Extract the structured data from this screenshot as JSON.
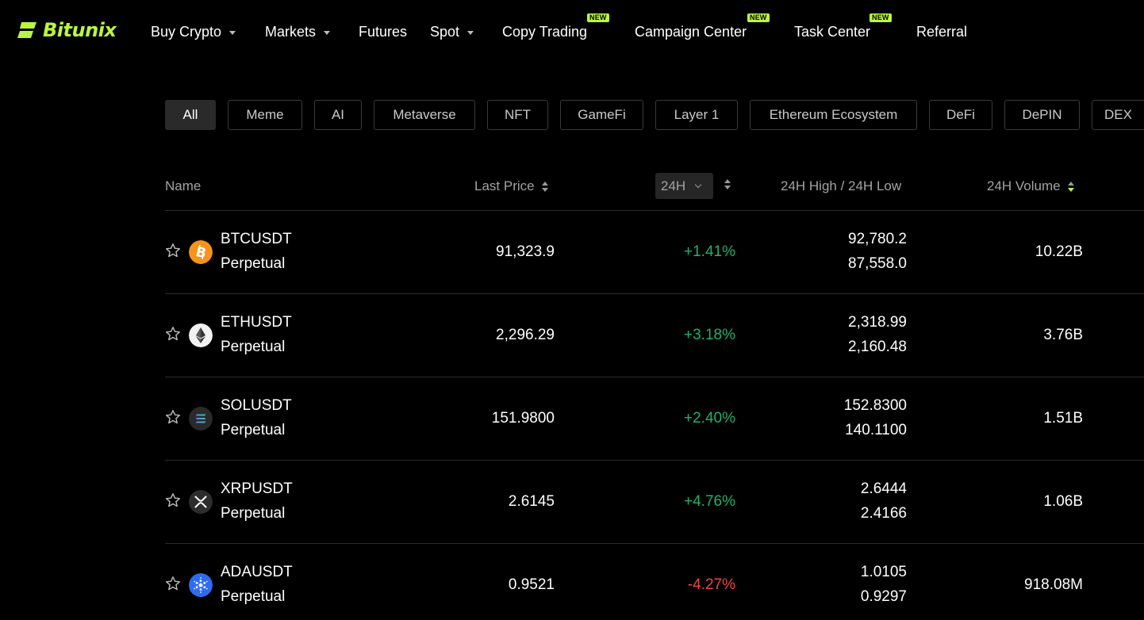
{
  "brand": {
    "name": "Bitunix",
    "accent_color": "#b9f641"
  },
  "nav": {
    "items": [
      {
        "label": "Buy Crypto",
        "dropdown": true
      },
      {
        "label": "Markets",
        "dropdown": true
      },
      {
        "label": "Futures",
        "dropdown": false
      },
      {
        "label": "Spot",
        "dropdown": true
      },
      {
        "label": "Copy Trading",
        "dropdown": false,
        "badge": "NEW"
      },
      {
        "label": "Campaign Center",
        "dropdown": false,
        "badge": "NEW"
      },
      {
        "label": "Task Center",
        "dropdown": false,
        "badge": "NEW"
      },
      {
        "label": "Referral",
        "dropdown": false
      }
    ]
  },
  "categories": {
    "selected": "All",
    "items": [
      "All",
      "Meme",
      "AI",
      "Metaverse",
      "NFT",
      "GameFi",
      "Layer 1",
      "Ethereum Ecosystem",
      "DeFi",
      "DePIN",
      "DEX"
    ]
  },
  "table": {
    "columns": {
      "name": "Name",
      "last_price": "Last Price",
      "period": "24H",
      "high_low": "24H High / 24H Low",
      "volume": "24H Volume"
    },
    "sorted_by": "24H Volume",
    "sort_direction": "descending",
    "positive_color": "#20b26c",
    "negative_color": "#ef454a",
    "rows": [
      {
        "symbol": "BTCUSDT",
        "type": "Perpetual",
        "coin_icon": "bitcoin-icon",
        "last_price": "91,323.9",
        "change": "+1.41%",
        "direction": "up",
        "high": "92,780.2",
        "low": "87,558.0",
        "volume": "10.22B"
      },
      {
        "symbol": "ETHUSDT",
        "type": "Perpetual",
        "coin_icon": "ethereum-icon",
        "last_price": "2,296.29",
        "change": "+3.18%",
        "direction": "up",
        "high": "2,318.99",
        "low": "2,160.48",
        "volume": "3.76B"
      },
      {
        "symbol": "SOLUSDT",
        "type": "Perpetual",
        "coin_icon": "solana-icon",
        "last_price": "151.9800",
        "change": "+2.40%",
        "direction": "up",
        "high": "152.8300",
        "low": "140.1100",
        "volume": "1.51B"
      },
      {
        "symbol": "XRPUSDT",
        "type": "Perpetual",
        "coin_icon": "xrp-icon",
        "last_price": "2.6145",
        "change": "+4.76%",
        "direction": "up",
        "high": "2.6444",
        "low": "2.4166",
        "volume": "1.06B"
      },
      {
        "symbol": "ADAUSDT",
        "type": "Perpetual",
        "coin_icon": "cardano-icon",
        "last_price": "0.9521",
        "change": "-4.27%",
        "direction": "down",
        "high": "1.0105",
        "low": "0.9297",
        "volume": "918.08M"
      }
    ]
  }
}
